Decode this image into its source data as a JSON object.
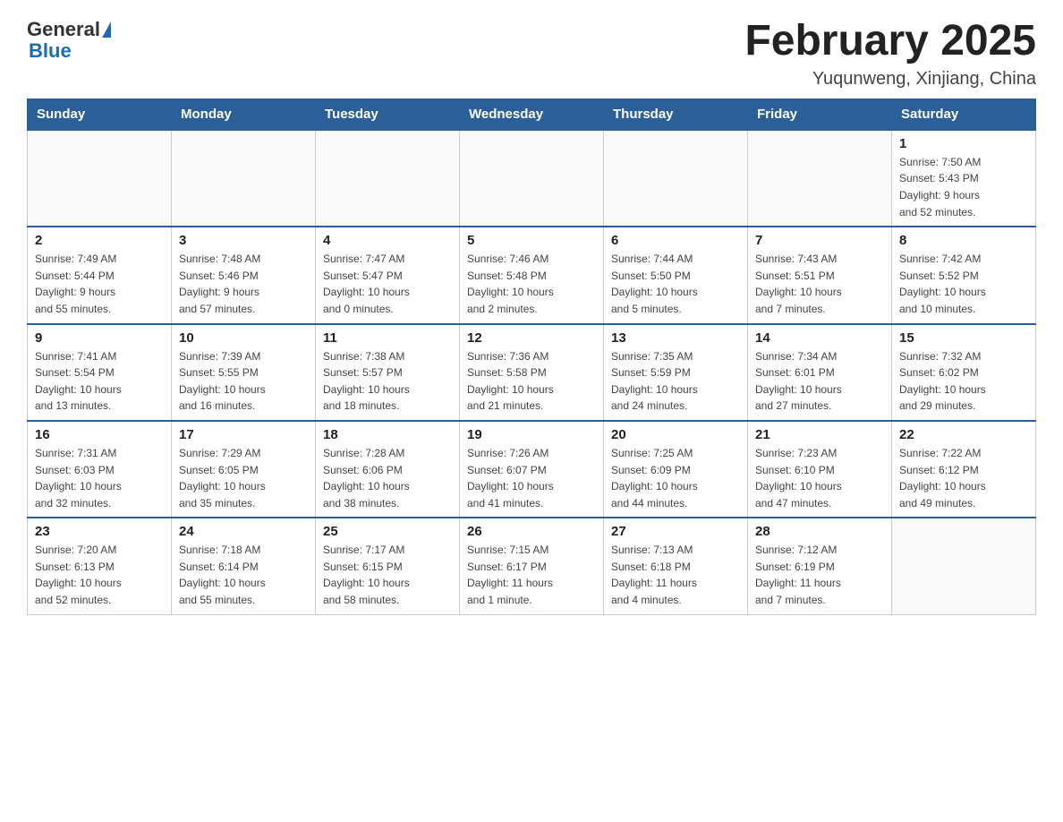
{
  "header": {
    "month_title": "February 2025",
    "location": "Yuqunweng, Xinjiang, China",
    "logo_general": "General",
    "logo_blue": "Blue"
  },
  "weekdays": [
    "Sunday",
    "Monday",
    "Tuesday",
    "Wednesday",
    "Thursday",
    "Friday",
    "Saturday"
  ],
  "weeks": [
    [
      {
        "day": "",
        "info": ""
      },
      {
        "day": "",
        "info": ""
      },
      {
        "day": "",
        "info": ""
      },
      {
        "day": "",
        "info": ""
      },
      {
        "day": "",
        "info": ""
      },
      {
        "day": "",
        "info": ""
      },
      {
        "day": "1",
        "info": "Sunrise: 7:50 AM\nSunset: 5:43 PM\nDaylight: 9 hours\nand 52 minutes."
      }
    ],
    [
      {
        "day": "2",
        "info": "Sunrise: 7:49 AM\nSunset: 5:44 PM\nDaylight: 9 hours\nand 55 minutes."
      },
      {
        "day": "3",
        "info": "Sunrise: 7:48 AM\nSunset: 5:46 PM\nDaylight: 9 hours\nand 57 minutes."
      },
      {
        "day": "4",
        "info": "Sunrise: 7:47 AM\nSunset: 5:47 PM\nDaylight: 10 hours\nand 0 minutes."
      },
      {
        "day": "5",
        "info": "Sunrise: 7:46 AM\nSunset: 5:48 PM\nDaylight: 10 hours\nand 2 minutes."
      },
      {
        "day": "6",
        "info": "Sunrise: 7:44 AM\nSunset: 5:50 PM\nDaylight: 10 hours\nand 5 minutes."
      },
      {
        "day": "7",
        "info": "Sunrise: 7:43 AM\nSunset: 5:51 PM\nDaylight: 10 hours\nand 7 minutes."
      },
      {
        "day": "8",
        "info": "Sunrise: 7:42 AM\nSunset: 5:52 PM\nDaylight: 10 hours\nand 10 minutes."
      }
    ],
    [
      {
        "day": "9",
        "info": "Sunrise: 7:41 AM\nSunset: 5:54 PM\nDaylight: 10 hours\nand 13 minutes."
      },
      {
        "day": "10",
        "info": "Sunrise: 7:39 AM\nSunset: 5:55 PM\nDaylight: 10 hours\nand 16 minutes."
      },
      {
        "day": "11",
        "info": "Sunrise: 7:38 AM\nSunset: 5:57 PM\nDaylight: 10 hours\nand 18 minutes."
      },
      {
        "day": "12",
        "info": "Sunrise: 7:36 AM\nSunset: 5:58 PM\nDaylight: 10 hours\nand 21 minutes."
      },
      {
        "day": "13",
        "info": "Sunrise: 7:35 AM\nSunset: 5:59 PM\nDaylight: 10 hours\nand 24 minutes."
      },
      {
        "day": "14",
        "info": "Sunrise: 7:34 AM\nSunset: 6:01 PM\nDaylight: 10 hours\nand 27 minutes."
      },
      {
        "day": "15",
        "info": "Sunrise: 7:32 AM\nSunset: 6:02 PM\nDaylight: 10 hours\nand 29 minutes."
      }
    ],
    [
      {
        "day": "16",
        "info": "Sunrise: 7:31 AM\nSunset: 6:03 PM\nDaylight: 10 hours\nand 32 minutes."
      },
      {
        "day": "17",
        "info": "Sunrise: 7:29 AM\nSunset: 6:05 PM\nDaylight: 10 hours\nand 35 minutes."
      },
      {
        "day": "18",
        "info": "Sunrise: 7:28 AM\nSunset: 6:06 PM\nDaylight: 10 hours\nand 38 minutes."
      },
      {
        "day": "19",
        "info": "Sunrise: 7:26 AM\nSunset: 6:07 PM\nDaylight: 10 hours\nand 41 minutes."
      },
      {
        "day": "20",
        "info": "Sunrise: 7:25 AM\nSunset: 6:09 PM\nDaylight: 10 hours\nand 44 minutes."
      },
      {
        "day": "21",
        "info": "Sunrise: 7:23 AM\nSunset: 6:10 PM\nDaylight: 10 hours\nand 47 minutes."
      },
      {
        "day": "22",
        "info": "Sunrise: 7:22 AM\nSunset: 6:12 PM\nDaylight: 10 hours\nand 49 minutes."
      }
    ],
    [
      {
        "day": "23",
        "info": "Sunrise: 7:20 AM\nSunset: 6:13 PM\nDaylight: 10 hours\nand 52 minutes."
      },
      {
        "day": "24",
        "info": "Sunrise: 7:18 AM\nSunset: 6:14 PM\nDaylight: 10 hours\nand 55 minutes."
      },
      {
        "day": "25",
        "info": "Sunrise: 7:17 AM\nSunset: 6:15 PM\nDaylight: 10 hours\nand 58 minutes."
      },
      {
        "day": "26",
        "info": "Sunrise: 7:15 AM\nSunset: 6:17 PM\nDaylight: 11 hours\nand 1 minute."
      },
      {
        "day": "27",
        "info": "Sunrise: 7:13 AM\nSunset: 6:18 PM\nDaylight: 11 hours\nand 4 minutes."
      },
      {
        "day": "28",
        "info": "Sunrise: 7:12 AM\nSunset: 6:19 PM\nDaylight: 11 hours\nand 7 minutes."
      },
      {
        "day": "",
        "info": ""
      }
    ]
  ]
}
